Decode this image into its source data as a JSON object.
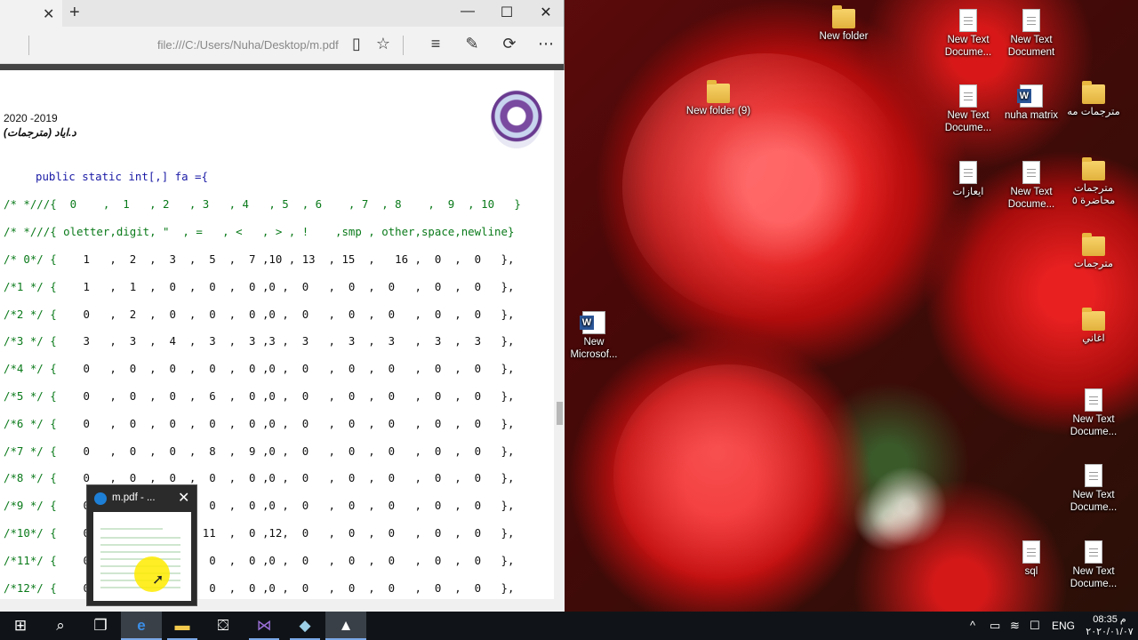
{
  "browser": {
    "url": "file:///C:/Users/Nuha/Desktop/m.pdf",
    "window_controls": {
      "minimize": "—",
      "maximize": "☐",
      "close": "✕"
    }
  },
  "pdf": {
    "year": "2020 -2019",
    "subtitle": "د.اياد (مترجمات)",
    "declaration": "public static int[,] fa ={",
    "header_indices": "/* *///{  0    ,  1   , 2   , 3   , 4   , 5  , 6    , 7  , 8    ,  9  , 10   }",
    "header_classes": "/* *///{ oletter,digit, \"  , =   , <   , > , !    ,smp , other,space,newline}",
    "rows": [
      {
        "label": "/* 0*/ {",
        "values": "    1   ,  2  ,  3  ,  5  ,  7 ,10 , 13  , 15  ,   16 ,  0  ,  0   },"
      },
      {
        "label": "/*1 */ {",
        "values": "    1   ,  1  ,  0  ,  0  ,  0 ,0 ,  0   ,  0  ,  0   ,  0  ,  0   },"
      },
      {
        "label": "/*2 */ {",
        "values": "    0   ,  2  ,  0  ,  0  ,  0 ,0 ,  0   ,  0  ,  0   ,  0  ,  0   },"
      },
      {
        "label": "/*3 */ {",
        "values": "    3   ,  3  ,  4  ,  3  ,  3 ,3 ,  3   ,  3  ,  3   ,  3  ,  3   },"
      },
      {
        "label": "/*4 */ {",
        "values": "    0   ,  0  ,  0  ,  0  ,  0 ,0 ,  0   ,  0  ,  0   ,  0  ,  0   },"
      },
      {
        "label": "/*5 */ {",
        "values": "    0   ,  0  ,  0  ,  6  ,  0 ,0 ,  0   ,  0  ,  0   ,  0  ,  0   },"
      },
      {
        "label": "/*6 */ {",
        "values": "    0   ,  0  ,  0  ,  0  ,  0 ,0 ,  0   ,  0  ,  0   ,  0  ,  0   },"
      },
      {
        "label": "/*7 */ {",
        "values": "    0   ,  0  ,  0  ,  8  ,  9 ,0 ,  0   ,  0  ,  0   ,  0  ,  0   },"
      },
      {
        "label": "/*8 */ {",
        "values": "    0   ,  0  ,  0  ,  0  ,  0 ,0 ,  0   ,  0  ,  0   ,  0  ,  0   },"
      },
      {
        "label": "/*9 */ {",
        "values": "    0   ,  0  ,  0  ,  0  ,  0 ,0 ,  0   ,  0  ,  0   ,  0  ,  0   },"
      },
      {
        "label": "/*10*/ {",
        "values": "    0   ,  0  ,  0  , 11  ,  0 ,12,  0   ,  0  ,  0   ,  0  ,  0   },"
      },
      {
        "label": "/*11*/ {",
        "values": "    0   ,  0  ,  0  ,  0  ,  0 ,0 ,  0   ,  0  ,  0   ,  0  ,  0   },"
      },
      {
        "label": "/*12*/ {",
        "values": "    0   ,  0  ,  0  ,  0  ,  0 ,0 ,  0   ,  0  ,  0   ,  0  ,  0   },"
      }
    ]
  },
  "thumbnail": {
    "title": "m.pdf - ...",
    "close": "✕"
  },
  "desktop_icons": [
    {
      "label": "New folder",
      "type": "zip-folder"
    },
    {
      "label": "New Text Docume...",
      "type": "text"
    },
    {
      "label": "New Text Document",
      "type": "text"
    },
    {
      "label": "New folder (9)",
      "type": "folder"
    },
    {
      "label": "New Text Docume...",
      "type": "text"
    },
    {
      "label": "nuha matrix",
      "type": "word"
    },
    {
      "label": "مترجمات مه",
      "type": "folder"
    },
    {
      "label": "ايعازات",
      "type": "text"
    },
    {
      "label": "New Text Docume...",
      "type": "text"
    },
    {
      "label": "مترجمات محاضرة ٥",
      "type": "folder"
    },
    {
      "label": "مترجمات",
      "type": "folder"
    },
    {
      "label": "New Microsof...",
      "type": "word"
    },
    {
      "label": "اغاني",
      "type": "zip-folder"
    },
    {
      "label": "New Text Docume...",
      "type": "text"
    },
    {
      "label": "New Text Docume...",
      "type": "text"
    },
    {
      "label": "sql",
      "type": "text"
    },
    {
      "label": "New Text Docume...",
      "type": "text"
    }
  ],
  "taskbar": {
    "language": "ENG",
    "time": "08:35 م",
    "date": "٢٠٢٠/٠١/٠٧"
  }
}
